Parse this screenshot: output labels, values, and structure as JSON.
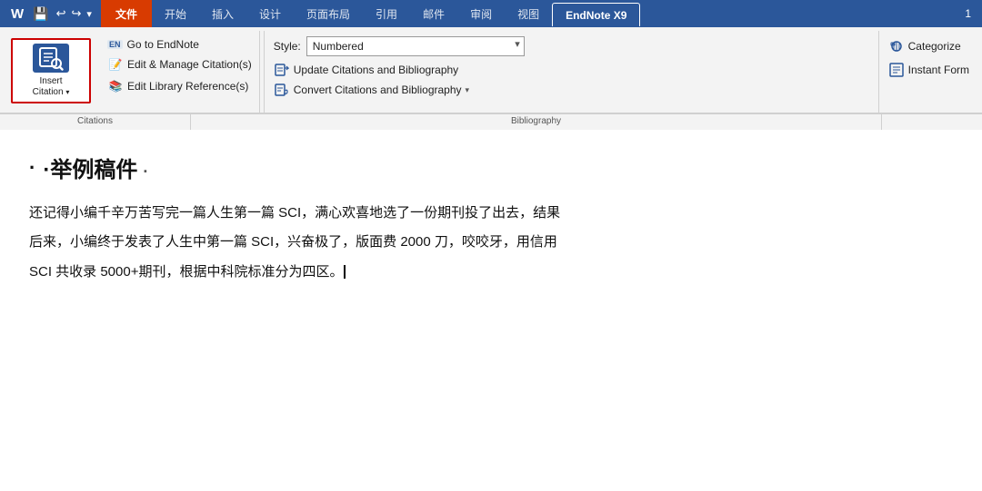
{
  "titlebar": {
    "number": "1"
  },
  "tabs": {
    "file": "文件",
    "items": [
      "开始",
      "插入",
      "设计",
      "页面布局",
      "引用",
      "邮件",
      "审阅",
      "视图"
    ],
    "active": "EndNote X9",
    "endnote": "EndNote X9"
  },
  "ribbon": {
    "insertCitation": {
      "line1": "Insert",
      "line2": "Citation",
      "dropArrow": "▾"
    },
    "citations": {
      "label": "Citations",
      "goToEndNote": "Go to EndNote",
      "editManage": "Edit & Manage Citation(s)",
      "editLibrary": "Edit Library Reference(s)"
    },
    "bibliography": {
      "label": "Bibliography",
      "styleLabel": "Style:",
      "styleValue": "Numbered",
      "updateCitations": "Update Citations and Bibliography",
      "convertCitations": "Convert Citations and Bibliography"
    },
    "extra": {
      "categorize": "Categorize",
      "instantForm": "Instant Form"
    }
  },
  "document": {
    "title": "·举例稿件",
    "paragraphs": [
      "还记得小编千辛万苦写完一篇人生第一篇 SCI，满心欢喜地选了一份期刊投了出去，结果",
      "后来，小编终于发表了人生中第一篇 SCI，兴奋极了，版面费 2000 刀，咬咬牙，用信用",
      "SCI 共收录 5000+期刊，根据中科院标准分为四区。"
    ]
  }
}
